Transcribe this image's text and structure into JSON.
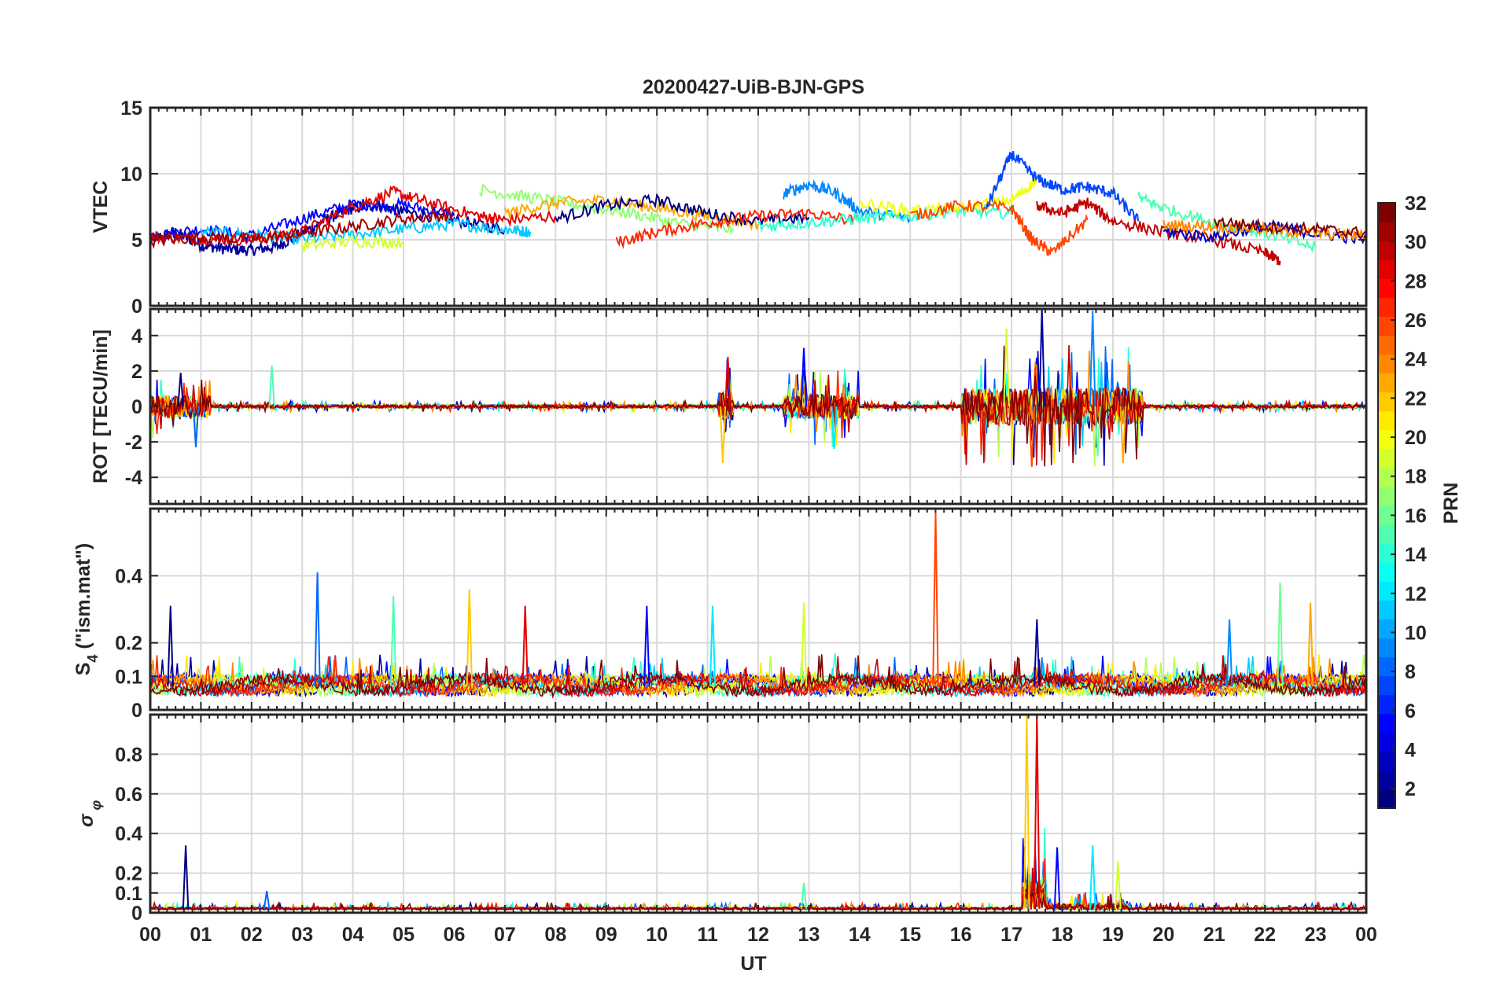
{
  "figure": {
    "title": "20200427-UiB-BJN-GPS"
  },
  "chart_data": [
    {
      "type": "line",
      "panel": "vtec",
      "ylabel": "VTEC",
      "ylim": [
        0,
        15
      ],
      "yticks": [
        0,
        5,
        10,
        15
      ],
      "xlim": [
        0,
        24
      ],
      "grid": true,
      "series": [
        {
          "prn": 2,
          "color_index": 2,
          "x": [
            0,
            0.5,
            1,
            1.5,
            2,
            2.5,
            3,
            3.5,
            4,
            4.5,
            5,
            6,
            7
          ],
          "y": [
            5.0,
            5.6,
            4.6,
            4.3,
            4.2,
            4.5,
            5.5,
            6.6,
            7.4,
            7.6,
            7.1,
            6.5,
            5.8
          ]
        },
        {
          "prn": 5,
          "color_index": 5,
          "x": [
            0,
            1,
            2,
            3,
            4,
            5,
            6
          ],
          "y": [
            5.3,
            5.8,
            5.3,
            6.6,
            7.7,
            7.6,
            6.9
          ]
        },
        {
          "prn": 11,
          "color_index": 11,
          "x": [
            1,
            2,
            3,
            4,
            5,
            6,
            7,
            7.5
          ],
          "y": [
            5.6,
            5.4,
            5.0,
            5.4,
            5.8,
            6.2,
            5.8,
            5.6
          ]
        },
        {
          "prn": 29,
          "color_index": 29,
          "x": [
            0,
            1,
            2,
            3,
            4,
            4.8,
            5.5,
            6.5,
            7,
            8
          ],
          "y": [
            5.2,
            5.1,
            5.0,
            5.6,
            7.5,
            8.6,
            7.8,
            6.8,
            6.5,
            6.8
          ]
        },
        {
          "prn": 31,
          "color_index": 31,
          "x": [
            0,
            1,
            2,
            3,
            4,
            5,
            6
          ],
          "y": [
            4.9,
            5.2,
            5.0,
            5.5,
            6.0,
            6.6,
            6.9
          ]
        },
        {
          "prn": 19,
          "color_index": 19,
          "x": [
            3,
            4,
            5
          ],
          "y": [
            4.5,
            4.9,
            4.8
          ]
        },
        {
          "prn": 17,
          "color_index": 17,
          "x": [
            6.5,
            7.5,
            8.5,
            9.5,
            10.5,
            11.5
          ],
          "y": [
            8.8,
            8.2,
            7.6,
            7.0,
            6.2,
            5.8
          ]
        },
        {
          "prn": 23,
          "color_index": 23,
          "x": [
            7,
            8,
            9,
            10,
            11,
            12
          ],
          "y": [
            7.0,
            7.8,
            8.0,
            7.4,
            6.8,
            6.2
          ]
        },
        {
          "prn": 1,
          "color_index": 1,
          "x": [
            8,
            9,
            10,
            11,
            12,
            13
          ],
          "y": [
            6.6,
            7.6,
            8.0,
            7.0,
            6.4,
            6.7
          ]
        },
        {
          "prn": 27,
          "color_index": 27,
          "x": [
            9.2,
            10,
            11,
            12,
            13,
            14
          ],
          "y": [
            4.8,
            5.6,
            6.3,
            6.8,
            7.0,
            6.4
          ]
        },
        {
          "prn": 9,
          "color_index": 9,
          "x": [
            12.5,
            13,
            13.5,
            14,
            15
          ],
          "y": [
            8.5,
            9.2,
            8.6,
            7.2,
            6.6
          ]
        },
        {
          "prn": 14,
          "color_index": 14,
          "x": [
            12,
            13,
            14,
            15,
            16,
            17
          ],
          "y": [
            6.0,
            6.3,
            6.6,
            6.8,
            7.2,
            7.0
          ]
        },
        {
          "prn": 20,
          "color_index": 20,
          "x": [
            14,
            15,
            16,
            17,
            17.5
          ],
          "y": [
            7.8,
            7.2,
            7.4,
            8.0,
            9.5
          ]
        },
        {
          "prn": 26,
          "color_index": 26,
          "x": [
            15,
            16,
            17,
            17.4,
            17.8,
            18.5
          ],
          "y": [
            6.8,
            7.6,
            7.4,
            5.0,
            4.0,
            6.5
          ]
        },
        {
          "prn": 7,
          "color_index": 7,
          "x": [
            16.5,
            17,
            17.5,
            18,
            18.5,
            19,
            19.5
          ],
          "y": [
            7.4,
            11.5,
            9.6,
            8.8,
            9.0,
            8.5,
            6.4
          ]
        },
        {
          "prn": 30,
          "color_index": 30,
          "x": [
            17.5,
            18,
            18.5,
            19,
            20,
            21,
            22,
            22.3
          ],
          "y": [
            7.6,
            7.0,
            7.8,
            6.4,
            5.6,
            5.0,
            4.0,
            3.4
          ]
        },
        {
          "prn": 15,
          "color_index": 15,
          "x": [
            19.5,
            20,
            21,
            22,
            23
          ],
          "y": [
            8.2,
            7.4,
            6.3,
            5.5,
            4.4
          ]
        },
        {
          "prn": 3,
          "color_index": 3,
          "x": [
            20,
            21,
            22,
            23,
            24
          ],
          "y": [
            5.6,
            5.2,
            6.1,
            5.5,
            5.0
          ]
        },
        {
          "prn": 24,
          "color_index": 24,
          "x": [
            20,
            21,
            22,
            23,
            24
          ],
          "y": [
            6.1,
            6.0,
            5.8,
            5.5,
            5.3
          ]
        },
        {
          "prn": 32,
          "color_index": 32,
          "x": [
            21,
            22,
            23,
            24
          ],
          "y": [
            6.4,
            6.0,
            5.8,
            5.5
          ]
        }
      ]
    },
    {
      "type": "line",
      "panel": "rot",
      "ylabel": "ROT [TECU/min]",
      "ylim": [
        -5.5,
        5.5
      ],
      "yticks": [
        -4,
        -2,
        0,
        2,
        4
      ],
      "xlim": [
        0,
        24
      ],
      "grid": true,
      "description_of_activity": "values near 0 with enhanced fluctuations around 00-01 UT, 12.5-14 UT and 16-19.5 UT",
      "peaks": {
        "x": [
          0.6,
          0.9,
          2.4,
          11.3,
          11.4,
          12.9,
          13.5,
          16.9,
          17.4,
          17.6,
          18.6,
          18.7,
          19.2
        ],
        "y": [
          1.9,
          -2.3,
          2.3,
          -3.2,
          2.8,
          3.3,
          -2.4,
          4.4,
          -3.4,
          5.5,
          5.4,
          -2.8,
          -3.2
        ]
      }
    },
    {
      "type": "line",
      "panel": "s4",
      "ylabel": "S4 (\"ism.mat\")",
      "ylim": [
        0,
        0.6
      ],
      "yticks": [
        0,
        0.1,
        0.2,
        0.4
      ],
      "xlim": [
        0,
        24
      ],
      "grid": true,
      "description_of_activity": "background 0.05-0.1 with spikes",
      "peaks": {
        "x": [
          0.4,
          3.3,
          4.8,
          6.3,
          7.4,
          9.8,
          11.1,
          12.9,
          15.5,
          17.5,
          21.3,
          22.3,
          22.9
        ],
        "y": [
          0.31,
          0.41,
          0.34,
          0.36,
          0.31,
          0.31,
          0.31,
          0.32,
          0.59,
          0.27,
          0.27,
          0.38,
          0.32
        ]
      }
    },
    {
      "type": "line",
      "panel": "sigma_phi",
      "ylabel": "σ φ",
      "ylim": [
        0,
        1
      ],
      "yticks": [
        0,
        0.1,
        0.2,
        0.4,
        0.6,
        0.8
      ],
      "xlim": [
        0,
        24
      ],
      "xlabel": "UT",
      "xticklabels": [
        "00",
        "01",
        "02",
        "03",
        "04",
        "05",
        "06",
        "07",
        "08",
        "09",
        "10",
        "11",
        "12",
        "13",
        "14",
        "15",
        "16",
        "17",
        "18",
        "19",
        "20",
        "21",
        "22",
        "23",
        "00"
      ],
      "grid": true,
      "description_of_activity": "background near 0.02 with spikes, saturation near 17.2-17.6 UT",
      "peaks": {
        "x": [
          0.7,
          2.3,
          12.9,
          17.3,
          17.5,
          17.9,
          18.6,
          19.1
        ],
        "y": [
          0.34,
          0.11,
          0.15,
          1.0,
          1.0,
          0.33,
          0.34,
          0.26
        ]
      }
    }
  ],
  "colorbar": {
    "label": "PRN",
    "ticks": [
      2,
      4,
      6,
      8,
      10,
      12,
      14,
      16,
      18,
      20,
      22,
      24,
      26,
      28,
      30,
      32
    ],
    "range": [
      1,
      32
    ],
    "colormap": "jet"
  }
}
